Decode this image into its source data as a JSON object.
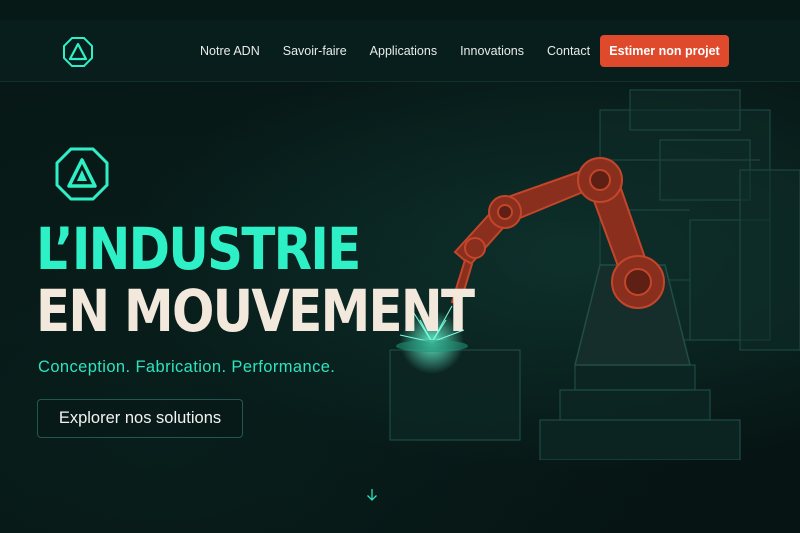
{
  "nav": {
    "logo_icon": "triangle-octagon-logo-icon",
    "links": [
      "Notre ADN",
      "Savoir-faire",
      "Applications",
      "Innovations",
      "Contact"
    ],
    "cta_label": "Estimer non projet"
  },
  "hero": {
    "logo_icon": "triangle-octagon-logo-icon",
    "title_line1": "L’INDUSTRIE",
    "title_line2": "EN MOUVEMENT",
    "tagline": "Conception. Fabrication. Performance.",
    "button_label": "Explorer nos solutions",
    "scroll_icon": "arrow-down-icon",
    "illustration": "robotic-arm-welding-illustration"
  },
  "colors": {
    "background": "#061413",
    "accent_teal": "#2ef0c6",
    "cta_orange": "#de4a2b",
    "title_cream": "#f2e8dc",
    "robot_red": "#a63a24"
  }
}
